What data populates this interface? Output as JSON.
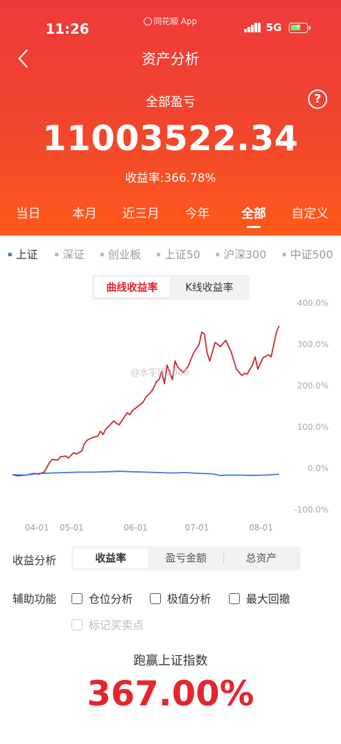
{
  "status": {
    "time": "11:26",
    "app_name": "同花顺 App",
    "network": "5G"
  },
  "nav": {
    "title": "资产分析"
  },
  "summary": {
    "label": "全部盈亏",
    "value": "11003522.34",
    "return_rate": "收益率:366.78%"
  },
  "range_tabs": [
    {
      "label": "当日"
    },
    {
      "label": "本月"
    },
    {
      "label": "近三月"
    },
    {
      "label": "今年"
    },
    {
      "label": "全部",
      "active": true
    },
    {
      "label": "自定义"
    }
  ],
  "index_options": [
    {
      "label": "上证",
      "active": true
    },
    {
      "label": "深证"
    },
    {
      "label": "创业板"
    },
    {
      "label": "上证50"
    },
    {
      "label": "沪深300"
    },
    {
      "label": "中证500"
    }
  ],
  "chart_toggle": {
    "curve": "曲线收益率",
    "kline": "K线收益率"
  },
  "watermark": "@水宇隆2006",
  "colors": {
    "accent": "#e3262e",
    "portfolio_line": "#c9262c",
    "index_line": "#3b79d8",
    "header_top": "#ef3a3a",
    "header_bottom": "#ff5a1a"
  },
  "chart_data": {
    "type": "line",
    "ylim": [
      -100,
      400
    ],
    "y_ticks": [
      "400.0%",
      "300.0%",
      "200.0%",
      "100.0%",
      "0.0%",
      "-100.0%"
    ],
    "x_ticks": [
      "04-01",
      "05-01",
      "06-01",
      "07-01",
      "08-01"
    ],
    "x_tick_positions": [
      0.105,
      0.235,
      0.475,
      0.705,
      0.945
    ],
    "series": [
      {
        "x": [
          0,
          0.02,
          0.05,
          0.08,
          0.1,
          0.12,
          0.14,
          0.15,
          0.17,
          0.18,
          0.2,
          0.21,
          0.22,
          0.23,
          0.24,
          0.26,
          0.27,
          0.28,
          0.3,
          0.32,
          0.33,
          0.34,
          0.35,
          0.37,
          0.38,
          0.4,
          0.42,
          0.43,
          0.44,
          0.45,
          0.47,
          0.49,
          0.5,
          0.52,
          0.53,
          0.54,
          0.55,
          0.56,
          0.57,
          0.58,
          0.6,
          0.61,
          0.62,
          0.64,
          0.66,
          0.67,
          0.68,
          0.7,
          0.71,
          0.72,
          0.73,
          0.74,
          0.76,
          0.78,
          0.8,
          0.82,
          0.84,
          0.86,
          0.87,
          0.88,
          0.9,
          0.91,
          0.92,
          0.94,
          0.96,
          0.97,
          0.99,
          1
        ],
        "values": [
          -15,
          -18,
          -16,
          -12,
          -14,
          -8,
          15,
          22,
          20,
          28,
          30,
          25,
          32,
          38,
          35,
          42,
          60,
          68,
          75,
          78,
          90,
          82,
          95,
          108,
          115,
          105,
          125,
          135,
          130,
          140,
          150,
          160,
          172,
          185,
          195,
          210,
          215,
          235,
          205,
          250,
          215,
          260,
          245,
          232,
          248,
          265,
          280,
          300,
          330,
          325,
          280,
          260,
          305,
          295,
          310,
          282,
          240,
          225,
          230,
          228,
          250,
          270,
          240,
          268,
          275,
          270,
          330,
          345
        ],
        "unit": "%"
      },
      {
        "x": [
          0,
          0.05,
          0.1,
          0.15,
          0.2,
          0.25,
          0.3,
          0.35,
          0.4,
          0.45,
          0.5,
          0.55,
          0.6,
          0.65,
          0.7,
          0.75,
          0.78,
          0.8,
          0.85,
          0.9,
          0.95,
          1
        ],
        "values": [
          -15,
          -16,
          -12,
          -11,
          -10,
          -9,
          -9,
          -8,
          -7,
          -8,
          -9,
          -10,
          -11,
          -10,
          -12,
          -13,
          -17,
          -16,
          -16,
          -17,
          -16,
          -14
        ],
        "unit": "%"
      }
    ]
  },
  "analysis": {
    "label": "收益分析",
    "options": [
      "收益率",
      "盈亏金额",
      "总资产"
    ]
  },
  "aux": {
    "label": "辅助功能",
    "position": "仓位分析",
    "extreme": "极值分析",
    "drawdown": "最大回撤",
    "mark_trades": "标记买卖点"
  },
  "beat": {
    "label": "跑赢上证指数",
    "value": "367.00%"
  }
}
